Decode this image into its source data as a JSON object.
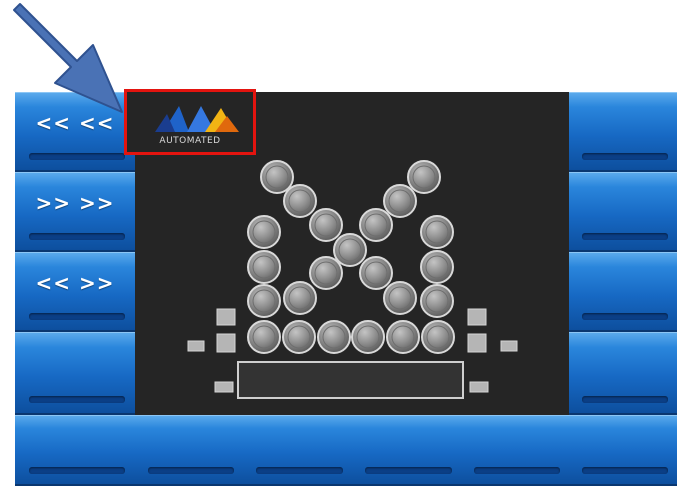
{
  "controls": {
    "left": [
      {
        "label": "<< <<"
      },
      {
        "label": ">> >>"
      },
      {
        "label": "<< >>"
      },
      {
        "label": ""
      },
      {
        "label": ""
      }
    ],
    "right": [
      {
        "label": ""
      },
      {
        "label": ""
      },
      {
        "label": ""
      },
      {
        "label": ""
      },
      {
        "label": ""
      }
    ],
    "bottom": [
      {
        "label": ""
      },
      {
        "label": ""
      },
      {
        "label": ""
      },
      {
        "label": ""
      }
    ]
  },
  "logo": {
    "text": "AUTOMATED"
  },
  "colors": {
    "button_blue": "#1769c4",
    "screen_background": "#252525",
    "highlight_red": "#e3140f",
    "arrow_blue": "#4a72b5"
  }
}
